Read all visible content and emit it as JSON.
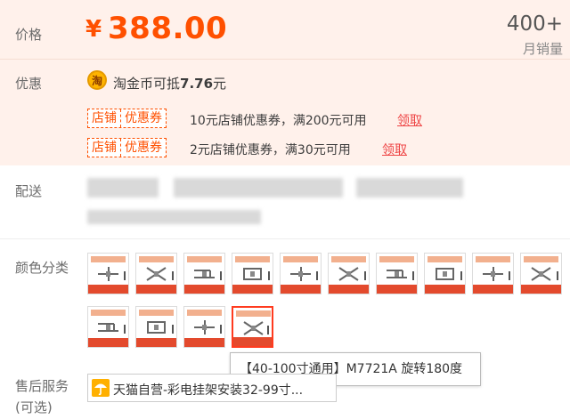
{
  "price": {
    "label": "价格",
    "currency": "¥",
    "value": "388.00",
    "sales_count": "400+",
    "sales_label": "月销量"
  },
  "promo": {
    "label": "优惠",
    "coin_icon": "淘",
    "coin_text": "淘金币可抵",
    "coin_amount": "7.76",
    "coin_unit": "元",
    "coupons": [
      {
        "tag_left": "店铺",
        "tag_right": "优惠券",
        "desc": "10元店铺优惠券，满200元可用",
        "action": "领取"
      },
      {
        "tag_left": "店铺",
        "tag_right": "优惠券",
        "desc": "2元店铺优惠券，满30元可用",
        "action": "领取"
      }
    ]
  },
  "delivery": {
    "label": "配送"
  },
  "color": {
    "label": "颜色分类",
    "selected_index": 13,
    "option_count": 14,
    "tooltip": "【40-100寸通用】M7721A 旋转180度"
  },
  "service": {
    "label": "售后服务",
    "sublabel": "(可选)",
    "icon": "umbrella-icon",
    "text": "天猫自营-彩电挂架安装32-99寸..."
  },
  "colors": {
    "accent": "#ff5000",
    "price_bg": "#fff1eb"
  }
}
